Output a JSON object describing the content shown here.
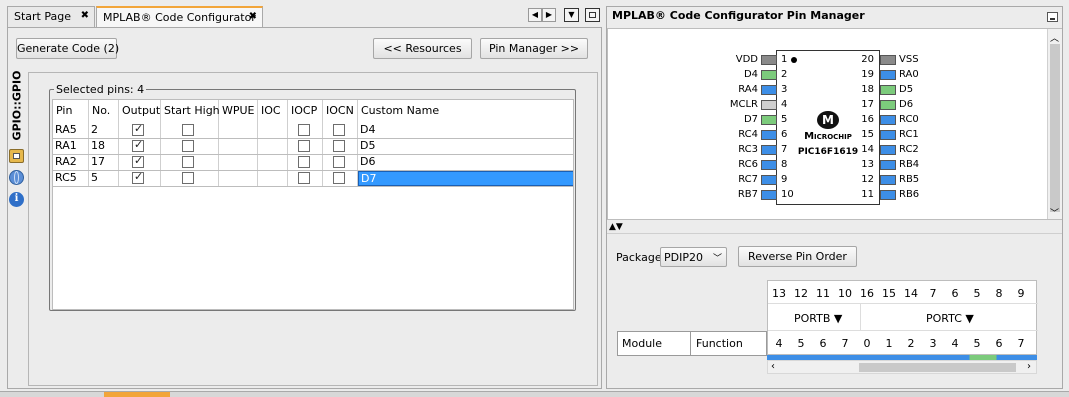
{
  "tabs": [
    {
      "label": "Start Page"
    },
    {
      "label": "MPLAB® Code Configurator"
    }
  ],
  "right_panel_title": "MPLAB® Code Configurator Pin Manager",
  "toolbar": {
    "generate": "Generate Code (2)",
    "resources": "<< Resources",
    "pin_manager": "Pin Manager >>"
  },
  "side_tab": "GPIO::GPIO",
  "selected_pins_label": "Selected pins: 4",
  "table": {
    "headers": [
      "Pin",
      "No.",
      "Output",
      "Start High",
      "WPUE",
      "IOC",
      "IOCP",
      "IOCN",
      "Custom Name"
    ],
    "rows": [
      {
        "pin": "RA5",
        "no": "2",
        "output": true,
        "start_high": false,
        "iocp": false,
        "iocn": false,
        "name": "D4",
        "selected": false
      },
      {
        "pin": "RA1",
        "no": "18",
        "output": true,
        "start_high": false,
        "iocp": false,
        "iocn": false,
        "name": "D5",
        "selected": false
      },
      {
        "pin": "RA2",
        "no": "17",
        "output": true,
        "start_high": false,
        "iocp": false,
        "iocn": false,
        "name": "D6",
        "selected": false
      },
      {
        "pin": "RC5",
        "no": "5",
        "output": true,
        "start_high": false,
        "iocp": false,
        "iocn": false,
        "name": "D7",
        "selected": true
      }
    ]
  },
  "chip": {
    "name": "PIC16F1619",
    "brand": "Microchip",
    "left_pins": [
      {
        "label": "VDD",
        "num": "1",
        "color": "#8a8a8a"
      },
      {
        "label": "D4",
        "num": "2",
        "color": "#7ccb7c"
      },
      {
        "label": "RA4",
        "num": "3",
        "color": "#3d8ee6"
      },
      {
        "label": "MCLR",
        "num": "4",
        "color": "#cfcfcf"
      },
      {
        "label": "D7",
        "num": "5",
        "color": "#7ccb7c"
      },
      {
        "label": "RC4",
        "num": "6",
        "color": "#3d8ee6"
      },
      {
        "label": "RC3",
        "num": "7",
        "color": "#3d8ee6"
      },
      {
        "label": "RC6",
        "num": "8",
        "color": "#3d8ee6"
      },
      {
        "label": "RC7",
        "num": "9",
        "color": "#3d8ee6"
      },
      {
        "label": "RB7",
        "num": "10",
        "color": "#3d8ee6"
      }
    ],
    "right_pins": [
      {
        "label": "VSS",
        "num": "20",
        "color": "#8a8a8a"
      },
      {
        "label": "RA0",
        "num": "19",
        "color": "#3d8ee6"
      },
      {
        "label": "D5",
        "num": "18",
        "color": "#7ccb7c"
      },
      {
        "label": "D6",
        "num": "17",
        "color": "#7ccb7c"
      },
      {
        "label": "RC0",
        "num": "16",
        "color": "#3d8ee6"
      },
      {
        "label": "RC1",
        "num": "15",
        "color": "#3d8ee6"
      },
      {
        "label": "RC2",
        "num": "14",
        "color": "#3d8ee6"
      },
      {
        "label": "RB4",
        "num": "13",
        "color": "#3d8ee6"
      },
      {
        "label": "RB5",
        "num": "12",
        "color": "#3d8ee6"
      },
      {
        "label": "RB6",
        "num": "11",
        "color": "#3d8ee6"
      }
    ]
  },
  "package": {
    "label": "Package",
    "value": "PDIP20",
    "reverse": "Reverse Pin Order"
  },
  "pin_grid": {
    "top_numbers": [
      "13",
      "12",
      "11",
      "10",
      "16",
      "15",
      "14",
      "7",
      "6",
      "5",
      "8",
      "9"
    ],
    "portb": "PORTB ▼",
    "portc": "PORTC ▼",
    "bottom_numbers": [
      "4",
      "5",
      "6",
      "7",
      "0",
      "1",
      "2",
      "3",
      "4",
      "5",
      "6",
      "7"
    ],
    "module_header": "Module",
    "function_header": "Function"
  },
  "colors": {
    "selection": "#3399ff",
    "tab_accent": "#f2a53a",
    "pin_blue": "#3d8ee6",
    "pin_green": "#7ccb7c"
  }
}
